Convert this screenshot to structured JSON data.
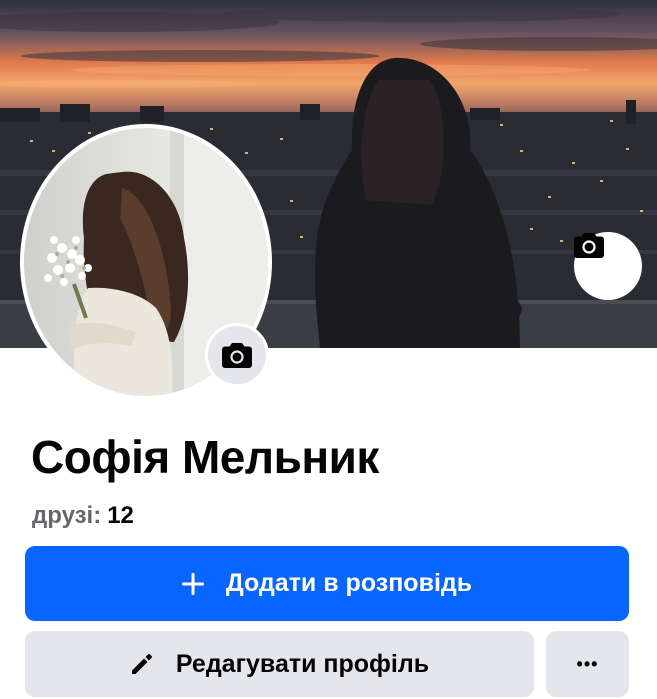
{
  "profile": {
    "name": "Софія Мельник",
    "friends_label": "друзі:",
    "friends_count": "12"
  },
  "actions": {
    "add_story_label": "Додати в розповідь",
    "edit_profile_label": "Редагувати профіль",
    "more_label": "•••"
  },
  "icons": {
    "cover_camera": "camera-icon",
    "avatar_camera": "camera-icon",
    "add_story": "plus-icon",
    "edit_profile": "pencil-icon",
    "more": "more-horizontal-icon"
  },
  "colors": {
    "primary_button": "#0866ff",
    "secondary_button": "#e4e6eb",
    "text": "#050505",
    "muted_text": "#65676b"
  }
}
